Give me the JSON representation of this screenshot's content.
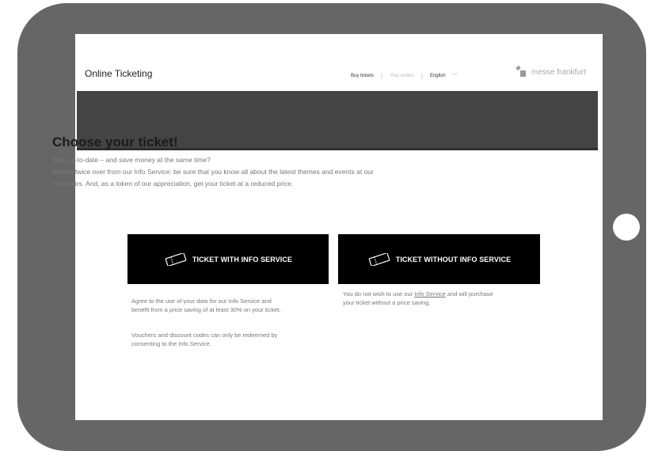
{
  "header": {
    "app_title": "Online Ticketing",
    "nav": {
      "buy_tickets": "Buy tickets",
      "your_orders": "Your orders",
      "language": "English"
    },
    "brand": "messe frankfurt"
  },
  "main": {
    "headline": "Choose your ticket!",
    "intro": [
      "Stay up-to-date – and save money at the same time?",
      "Benefit twice over from our Info Service: be sure that you know all about the latest themes and events at our",
      "trade fairs. And, as a token of our appreciation, get your ticket at a reduced price."
    ],
    "option_with": {
      "label": "TICKET WITH INFO SERVICE",
      "desc_1_line_1": "Agree to the use of your data for our Info Service and",
      "desc_1_line_2": "benefit from a price saving of at least 30% on your ticket.",
      "desc_2_line_1": "Vouchers and discount codes can only be redeemed by",
      "desc_2_line_2": "consenting to the Info Service."
    },
    "option_without": {
      "label": "TICKET WITHOUT INFO SERVICE",
      "desc_pre": "You do not wish to use our ",
      "desc_link": "Info Service",
      "desc_post": " and will purchase",
      "desc_line_2": "your ticket without a price saving."
    }
  },
  "colors": {
    "tablet_frame": "#666666",
    "banner": "#444444",
    "button_bg": "#000000",
    "button_text": "#ffffff"
  },
  "icons": {
    "ticket": "ticket-icon",
    "language_dropdown": "chevron-down-icon",
    "brand": "messe-frankfurt-logo-icon"
  }
}
